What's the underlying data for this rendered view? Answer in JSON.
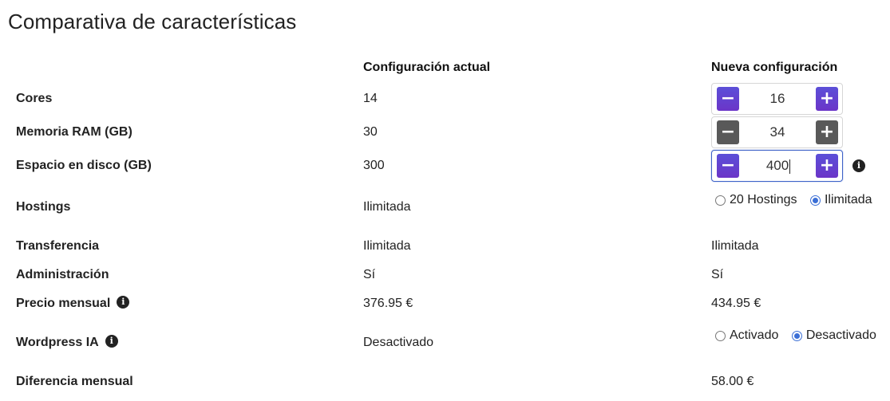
{
  "title": "Comparativa de características",
  "headers": {
    "current": "Configuración actual",
    "new": "Nueva configuración"
  },
  "rows": {
    "cores": {
      "label": "Cores",
      "current": "14",
      "new_value": "16"
    },
    "ram": {
      "label": "Memoria RAM (GB)",
      "current": "30",
      "new_value": "34"
    },
    "disk": {
      "label": "Espacio en disco (GB)",
      "current": "300",
      "new_value": "400"
    },
    "hostings": {
      "label": "Hostings",
      "current": "Ilimitada",
      "options": [
        "20 Hostings",
        "Ilimitada"
      ],
      "selected": "Ilimitada"
    },
    "transfer": {
      "label": "Transferencia",
      "current": "Ilimitada",
      "new": "Ilimitada"
    },
    "admin": {
      "label": "Administración",
      "current": "Sí",
      "new": "Sí"
    },
    "price": {
      "label": "Precio mensual",
      "current": "376.95 €",
      "new": "434.95 €"
    },
    "wordpress": {
      "label": "Wordpress IA",
      "current": "Desactivado",
      "options": [
        "Activado",
        "Desactivado"
      ],
      "selected": "Desactivado"
    },
    "diff": {
      "label": "Diferencia mensual",
      "new": "58.00 €"
    }
  },
  "stepper": {
    "minus": "−",
    "plus": "+"
  },
  "icons": {
    "info": "info-icon",
    "info_glyph": "i"
  },
  "colors": {
    "accent": "#5b4fd8",
    "disabled": "#595959",
    "radio": "#3b6fd6"
  }
}
